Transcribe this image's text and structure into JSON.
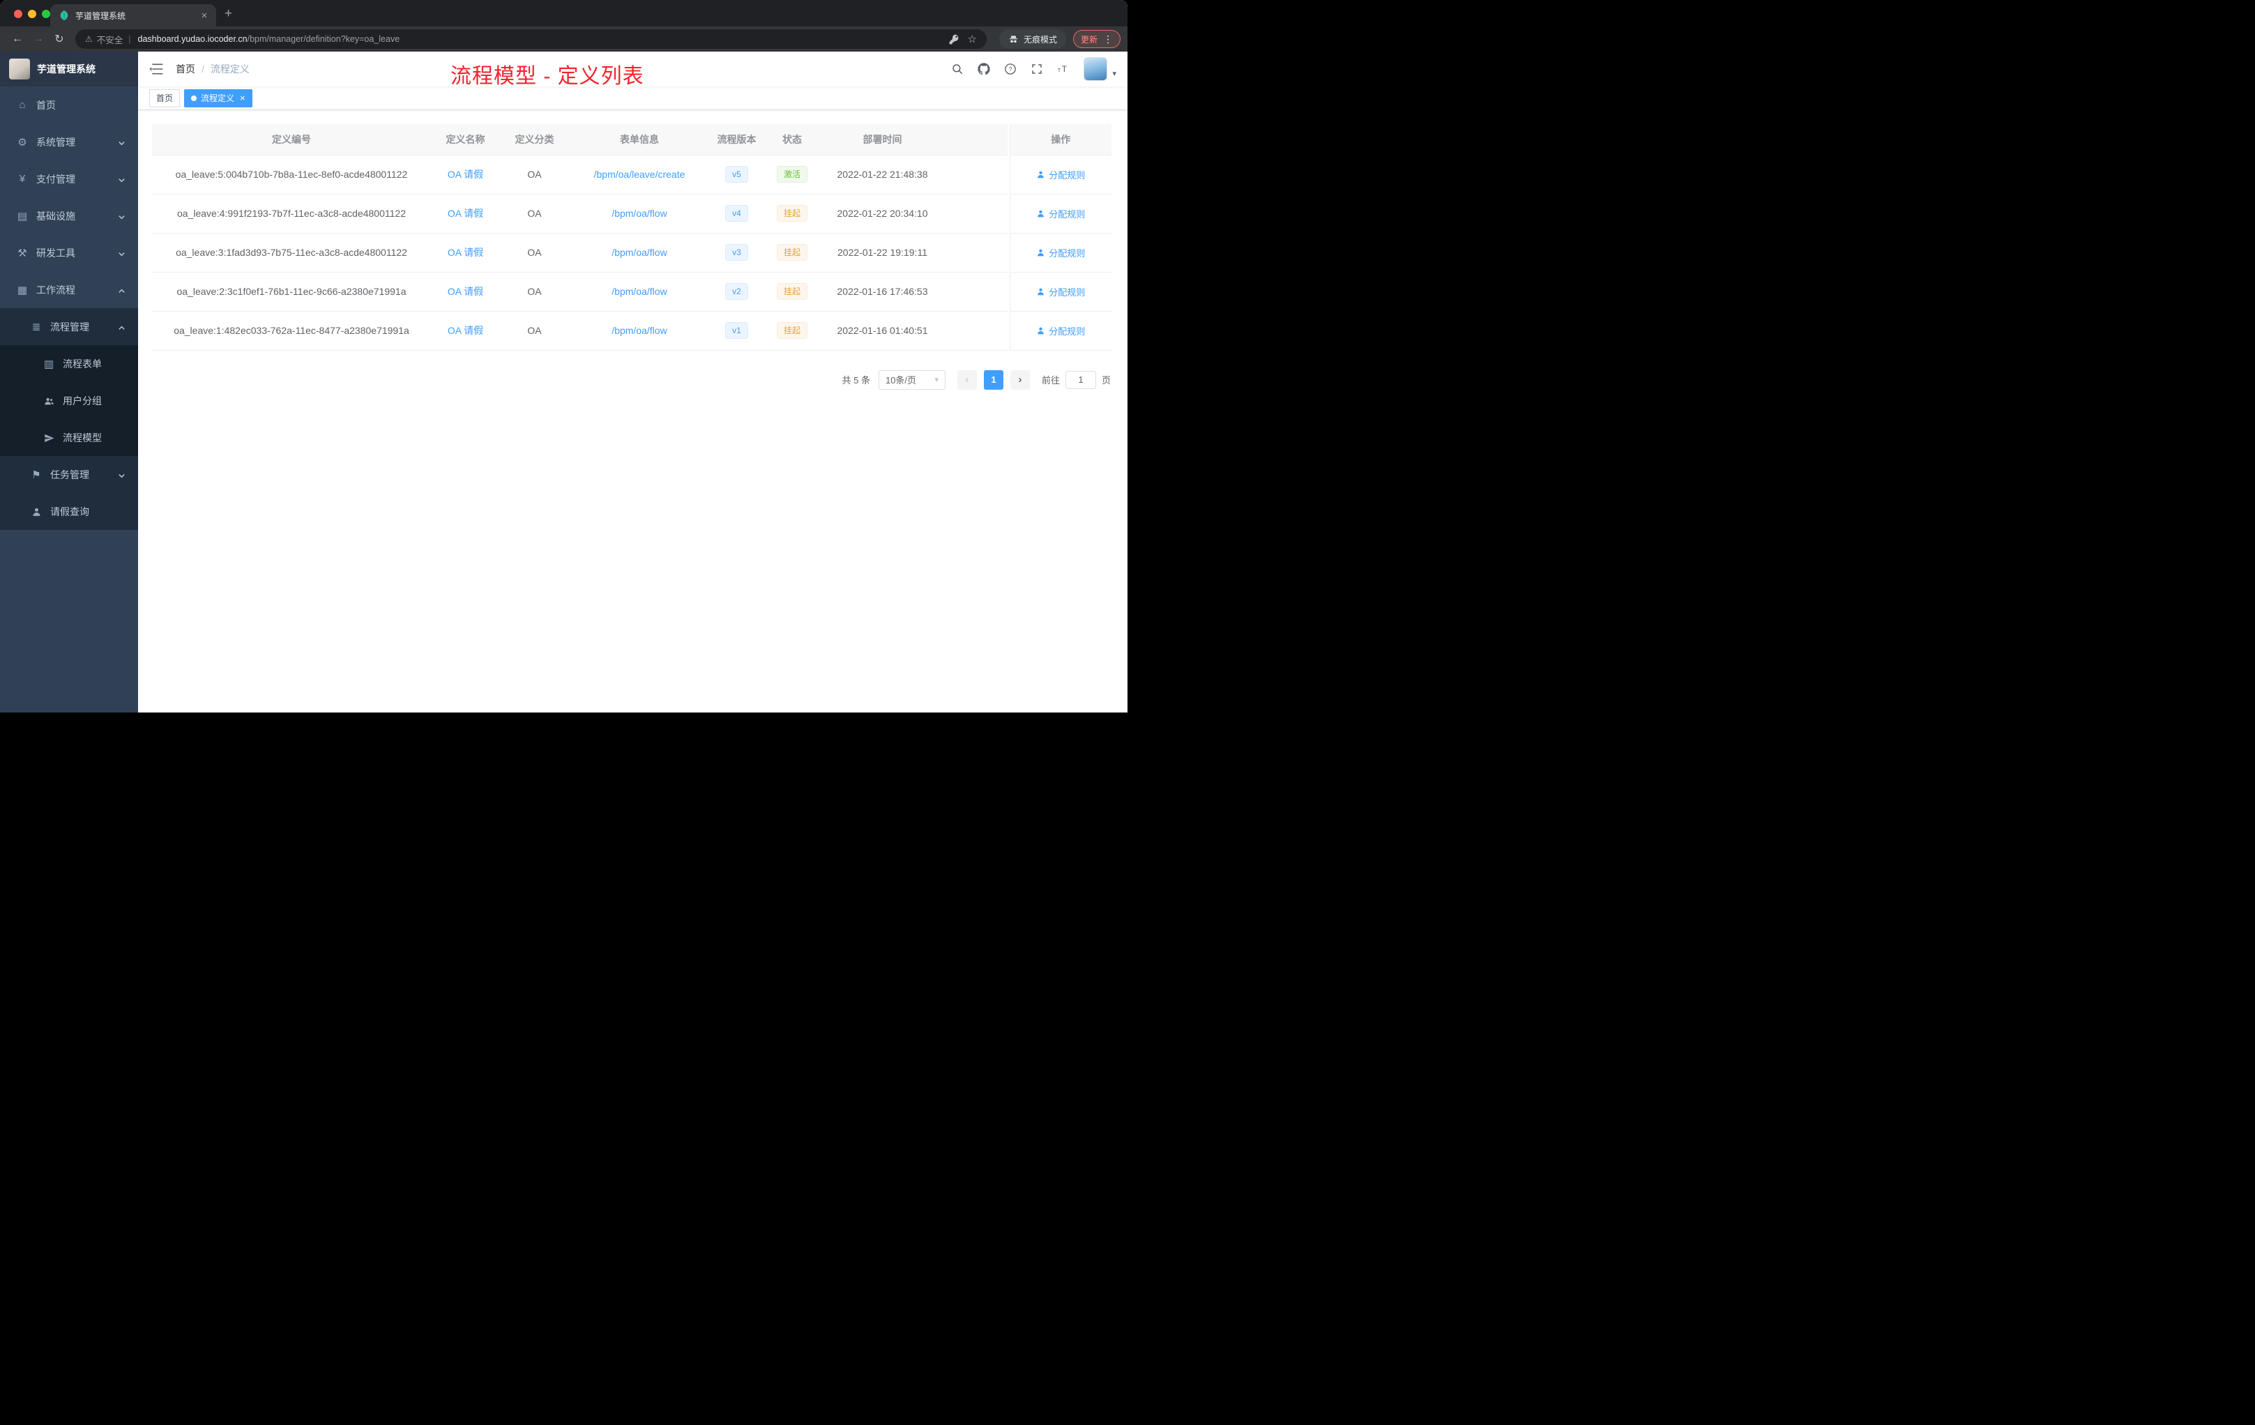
{
  "browser": {
    "tab_title": "芋道管理系统",
    "security_label": "不安全",
    "url_host": "dashboard.yudao.iocoder.cn",
    "url_path": "/bpm/manager/definition?key=oa_leave",
    "incognito_label": "无痕模式",
    "update_label": "更新"
  },
  "icons": {
    "close": "×",
    "new_tab": "+",
    "back": "←",
    "forward": "→",
    "reload": "↻",
    "warning": "⚠",
    "divider": "|",
    "star": "☆",
    "menu_dots": "⋮",
    "home": "⌂",
    "gear": "⚙",
    "yen": "¥",
    "infra": "▤",
    "tools": "⚒",
    "workflow": "▦",
    "process": "≣",
    "form": "▥",
    "flag": "⚑",
    "prev": "‹",
    "next": "›",
    "caret_down": "▾",
    "question": "?",
    "font_t": "T"
  },
  "sidebar": {
    "app_title": "芋道管理系统",
    "items": [
      {
        "label": "首页"
      },
      {
        "label": "系统管理"
      },
      {
        "label": "支付管理"
      },
      {
        "label": "基础设施"
      },
      {
        "label": "研发工具"
      },
      {
        "label": "工作流程"
      },
      {
        "label": "流程管理"
      },
      {
        "label": "流程表单"
      },
      {
        "label": "用户分组"
      },
      {
        "label": "流程模型"
      },
      {
        "label": "任务管理"
      },
      {
        "label": "请假查询"
      }
    ]
  },
  "header": {
    "breadcrumb_home": "首页",
    "breadcrumb_separator": "/",
    "breadcrumb_current": "流程定义"
  },
  "annotation": {
    "text": "流程模型 - 定义列表",
    "color": "#f5222d"
  },
  "tags": {
    "home": "首页",
    "active": "流程定义"
  },
  "table": {
    "columns": [
      "定义编号",
      "定义名称",
      "定义分类",
      "表单信息",
      "流程版本",
      "状态",
      "部署时间",
      "操作"
    ],
    "rows": [
      {
        "id": "oa_leave:5:004b710b-7b8a-11ec-8ef0-acde48001122",
        "name": "OA 请假",
        "category": "OA",
        "form": "/bpm/oa/leave/create",
        "version": "v5",
        "status": "激活",
        "time": "2022-01-22 21:48:38",
        "action": "分配规则"
      },
      {
        "id": "oa_leave:4:991f2193-7b7f-11ec-a3c8-acde48001122",
        "name": "OA 请假",
        "category": "OA",
        "form": "/bpm/oa/flow",
        "version": "v4",
        "status": "挂起",
        "time": "2022-01-22 20:34:10",
        "action": "分配规则"
      },
      {
        "id": "oa_leave:3:1fad3d93-7b75-11ec-a3c8-acde48001122",
        "name": "OA 请假",
        "category": "OA",
        "form": "/bpm/oa/flow",
        "version": "v3",
        "status": "挂起",
        "time": "2022-01-22 19:19:11",
        "action": "分配规则"
      },
      {
        "id": "oa_leave:2:3c1f0ef1-76b1-11ec-9c66-a2380e71991a",
        "name": "OA 请假",
        "category": "OA",
        "form": "/bpm/oa/flow",
        "version": "v2",
        "status": "挂起",
        "time": "2022-01-16 17:46:53",
        "action": "分配规则"
      },
      {
        "id": "oa_leave:1:482ec033-762a-11ec-8477-a2380e71991a",
        "name": "OA 请假",
        "category": "OA",
        "form": "/bpm/oa/flow",
        "version": "v1",
        "status": "挂起",
        "time": "2022-01-16 01:40:51",
        "action": "分配规则"
      }
    ]
  },
  "pagination": {
    "total": "共 5 条",
    "page_size": "10条/页",
    "current_page": "1",
    "goto_label": "前往",
    "goto_value": "1",
    "page_unit": "页"
  },
  "colors": {
    "accent": "#409eff",
    "annotation_red": "#f5222d",
    "status_active": "#67c23a",
    "status_suspended": "#e6a23c",
    "sidebar_bg": "#304156"
  }
}
